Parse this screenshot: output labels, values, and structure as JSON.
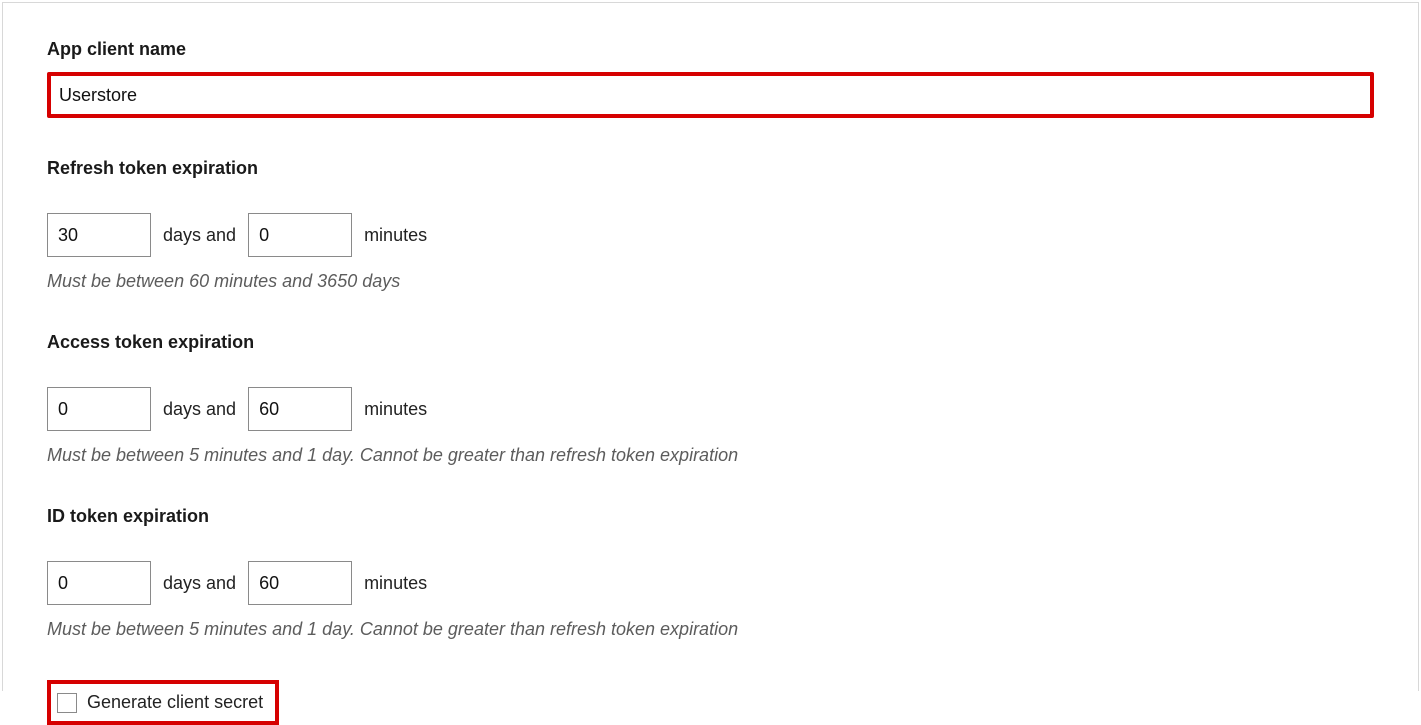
{
  "appClientName": {
    "label": "App client name",
    "value": "Userstore"
  },
  "refreshToken": {
    "label": "Refresh token expiration",
    "days": "30",
    "minutes": "0",
    "daysAnd": "days and",
    "minutesLabel": "minutes",
    "hint": "Must be between 60 minutes and 3650 days"
  },
  "accessToken": {
    "label": "Access token expiration",
    "days": "0",
    "minutes": "60",
    "daysAnd": "days and",
    "minutesLabel": "minutes",
    "hint": "Must be between 5 minutes and 1 day. Cannot be greater than refresh token expiration"
  },
  "idToken": {
    "label": "ID token expiration",
    "days": "0",
    "minutes": "60",
    "daysAnd": "days and",
    "minutesLabel": "minutes",
    "hint": "Must be between 5 minutes and 1 day. Cannot be greater than refresh token expiration"
  },
  "generateClientSecret": {
    "label": "Generate client secret"
  }
}
